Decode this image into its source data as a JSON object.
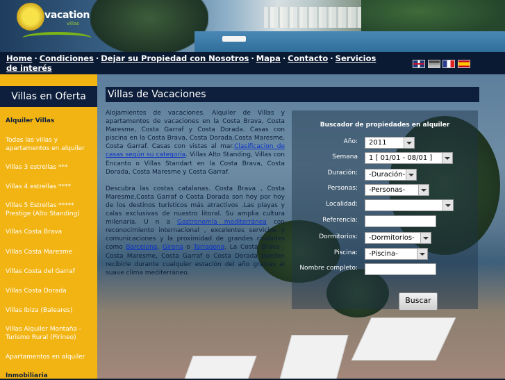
{
  "logo": {
    "word": "vacation",
    "sub": "villas"
  },
  "nav": {
    "items": [
      "Home",
      "Condiciones",
      "Dejar su Propiedad con Nosotros",
      "Mapa",
      "Contacto",
      "Servicios de interés"
    ],
    "separator": "·"
  },
  "languages": [
    "English",
    "Deutsch",
    "Français",
    "Español"
  ],
  "sidebar": {
    "title": "Villas en Oferta",
    "items": [
      "Alquiler Villas",
      "Todas las villas y apartamentos en alquiler",
      "Villas 3 estrellas ***",
      "Villas 4 estrellas ****",
      "Villas 5 Estrellas ***** Prestige (Alto Standing)",
      "Villas Costa Brava",
      "Villas Costa Maresme",
      "Villas Costa del Garraf",
      "Villas Costa Dorada",
      "Villas Ibiza (Baleares)",
      "Villas Alquiler Montaña - Turismo Rural (Pirineo)",
      "Apartamentos en alquiler",
      "Inmobiliaria"
    ]
  },
  "main": {
    "title": "Villas de Vacaciones",
    "p1_a": "Alojamientos de vacaciones. Alquiler de Villas y apartamentos de vacaciones en la Costa Brava, Costa Maresme, Costa Garraf y Costa Dorada. Casas con piscina en la Costa Brava, Costa Dorada,Costa Maresme, Costa Garraf. Casas con vistas al mar.",
    "p1_link": "Clasificacion de casas según su categoría",
    "p1_b": ". Villas Alto Standing, Villas con Encanto o Villas Standart en la Costa Brava, Costa Dorada, Costa Maresme y Costa Garraf.",
    "p2_a": "Descubra las costas catalanas. Costa Brava , Costa Maresme,Costa Garraf o Costa Dorada son hoy por hoy de los destinos turísticos más atractivos .Las playas y calas exclusivas de nuestro litoral. Su amplia cultura milenaria. U n a ",
    "p2_link1": "Gastronomía mediterránea",
    "p2_b": " con reconocimiento internacional , excelentes servicios y comunicaciones y la proximidad de grandes ciudades como ",
    "p2_link2": "Barcelona",
    "p2_c": ", ",
    "p2_link3": "Girona",
    "p2_d": " o ",
    "p2_link4": "Tarragona",
    "p2_e": ". La Costa Brava , Costa Maresme, Costa Garraf o Costa Dorada pueden recibirle durante cualquier estación del año gracias al suave clima mediterráneo."
  },
  "search": {
    "title": "Buscador de propiedades en alquiler",
    "labels": [
      "Año:",
      "Semana",
      "Duración:",
      "Personas:",
      "Localidad:",
      "Referencia:",
      "Dormitorios:",
      "Piscina:",
      "Nombre completo:"
    ],
    "year": "2011",
    "week": "1 [ 01/01 - 08/01 ]",
    "duration": "-Duración-",
    "persons": "-Personas-",
    "locality": "",
    "reference": "",
    "bedrooms": "-Dormitorios-",
    "pool": "-Piscina-",
    "fullname": "",
    "button": "Buscar"
  }
}
